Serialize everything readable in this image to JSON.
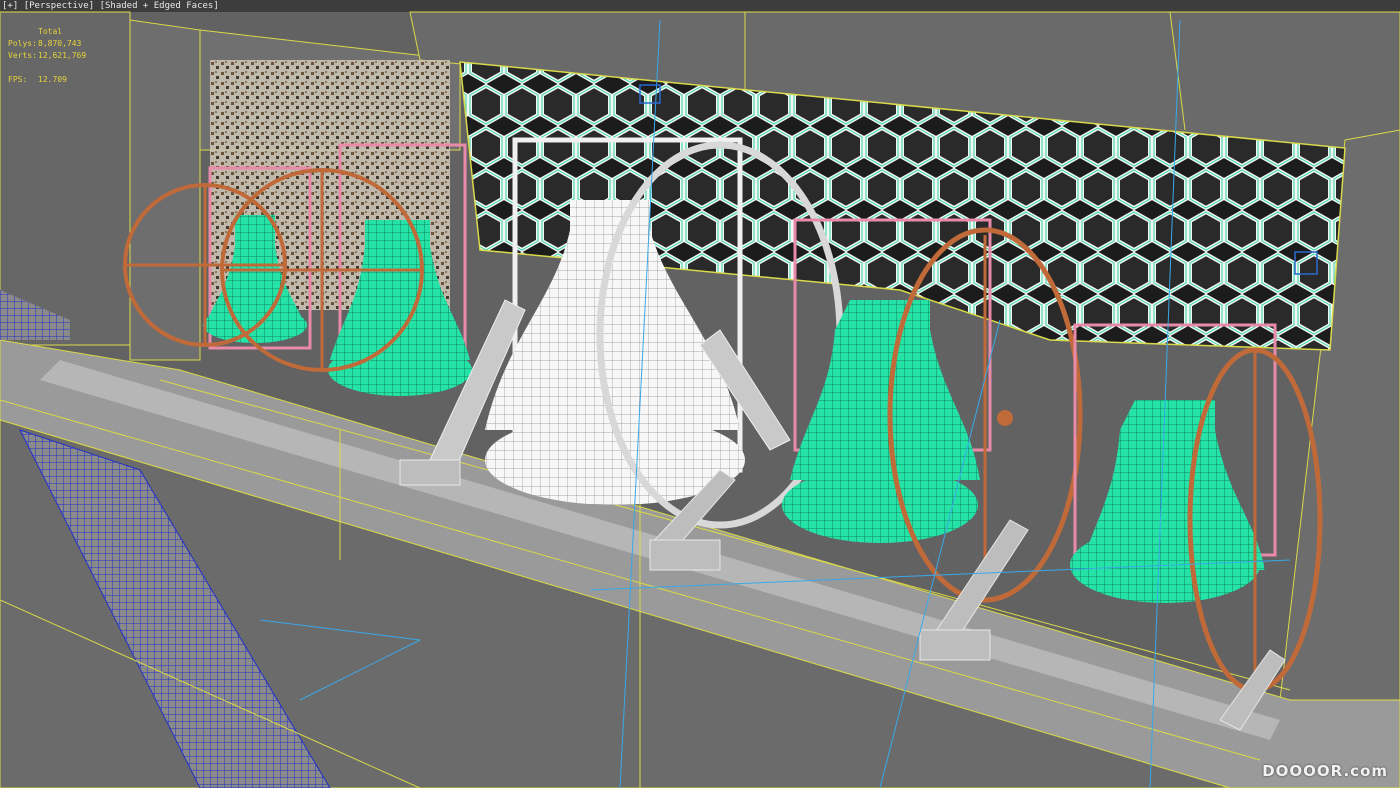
{
  "viewport": {
    "label_plus": "[+]",
    "label_view": "[Perspective]",
    "label_shading": "[Shaded + Edged Faces]",
    "colors": {
      "background": "#616161",
      "stats_text": "#e5d33a",
      "bell_selected": "#20e0a0",
      "bell_main": "#ffffff",
      "wheel": "#c06a3a",
      "headstock": "#e88aa8",
      "frame_edges": "#e0e060",
      "guide_lines": "#3aa8e8",
      "grille": "#1e1e1e"
    }
  },
  "stats": {
    "header": "Total",
    "polys_label": "Polys:",
    "polys_value": "8,870,743",
    "verts_label": "Verts:",
    "verts_value": "12,621,769",
    "fps_label": "FPS:",
    "fps_value": "12.709"
  },
  "watermark": "DOOOOR.com"
}
